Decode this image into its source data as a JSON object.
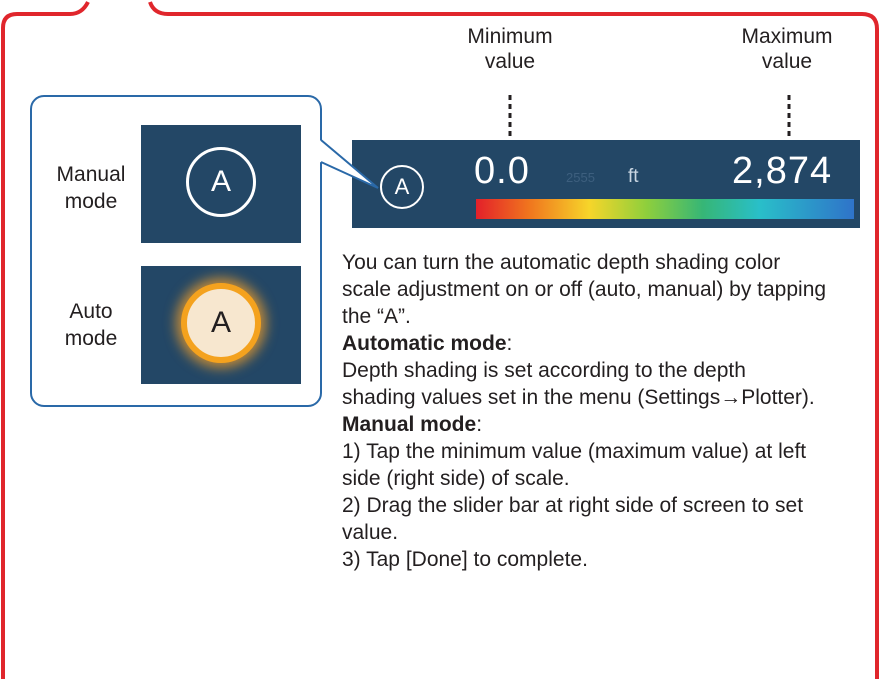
{
  "callouts": {
    "min_label_line1": "Minimum",
    "min_label_line2": "value",
    "max_label_line1": "Maximum",
    "max_label_line2": "value"
  },
  "depth_bar": {
    "mode_button": "A",
    "min_value": "0.0",
    "unit": "ft",
    "max_value": "2,874",
    "ghost_text": "2555"
  },
  "modes": {
    "manual_line1": "Manual",
    "manual_line2": "mode",
    "manual_button": "A",
    "auto_line1": "Auto",
    "auto_line2": "mode",
    "auto_button": "A"
  },
  "description": {
    "intro": "You can turn the automatic depth shading color scale adjustment on or off (auto, manual) by tapping the “A”.",
    "auto_heading": "Automatic mode",
    "auto_text": "Depth shading is set according to the depth shading values set in the menu (Settings→Plotter).",
    "manual_heading": "Manual mode",
    "step1": "1) Tap the minimum value (maximum value) at left side (right side) of scale.",
    "step2": "2) Drag the slider bar at right side of screen to set value.",
    "step3": "3) Tap [Done] to complete."
  },
  "colors": {
    "frame_red": "#e0262c",
    "box_blue": "#2a69a8",
    "bar_navy": "#234766",
    "auto_glow": "#f4a21e"
  }
}
